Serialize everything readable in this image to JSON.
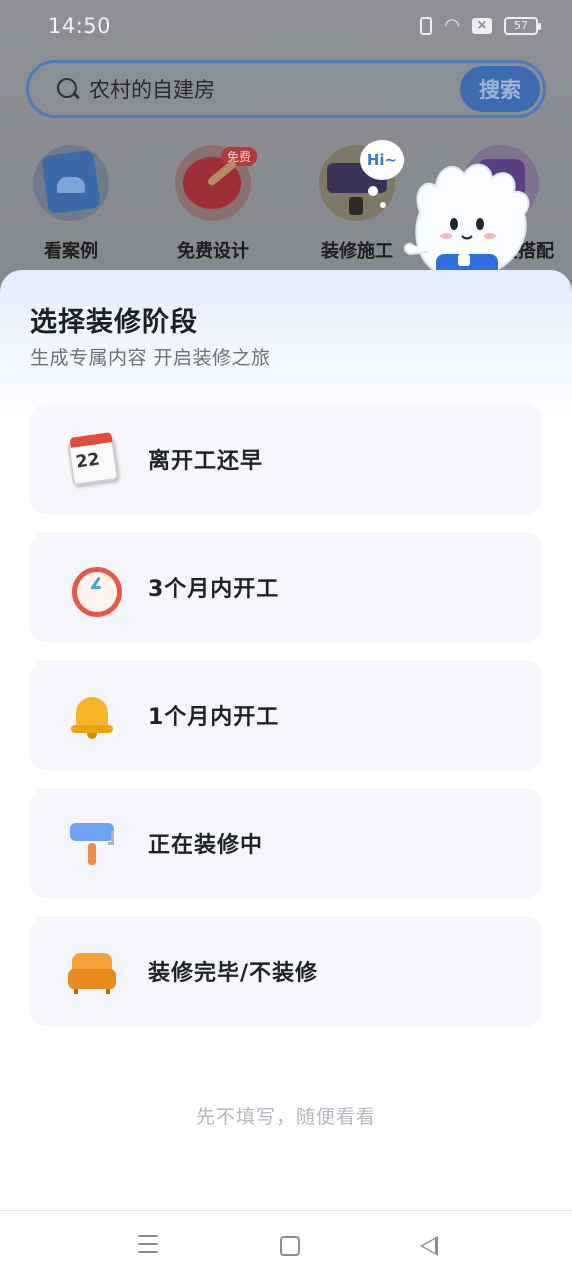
{
  "status_bar": {
    "time": "14:50",
    "battery": "57"
  },
  "search": {
    "query": "农村的自建房",
    "button_label": "搜索"
  },
  "quick_nav": [
    {
      "label": "看案例",
      "icon": "photo-icon"
    },
    {
      "label": "免费设计",
      "icon": "palette-icon",
      "badge": "免费"
    },
    {
      "label": "装修施工",
      "icon": "paint-roller-icon"
    },
    {
      "label": "装搭配",
      "icon": "sofa-icon"
    }
  ],
  "mascot": {
    "greeting": "Hi~"
  },
  "sheet": {
    "title": "选择装修阶段",
    "subtitle": "生成专属内容 开启装修之旅",
    "options": [
      {
        "label": "离开工还早",
        "icon": "calendar-icon"
      },
      {
        "label": "3个月内开工",
        "icon": "clock-icon"
      },
      {
        "label": "1个月内开工",
        "icon": "bell-icon"
      },
      {
        "label": "正在装修中",
        "icon": "paint-roller-icon"
      },
      {
        "label": "装修完毕/不装修",
        "icon": "sofa-icon"
      }
    ],
    "skip_label": "先不填写，随便看看"
  },
  "colors": {
    "accent": "#3d6bb0",
    "option_bg": "#f5f6fa",
    "sheet_header_tint": "#e3ecfb"
  }
}
